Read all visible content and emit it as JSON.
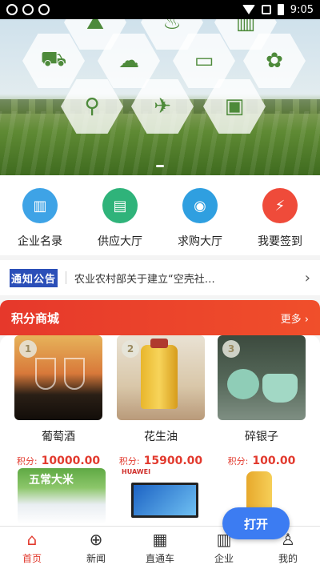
{
  "status_bar": {
    "time": "9:05"
  },
  "banner": {
    "hexagon_icons": [
      "mountain-icon",
      "pot-icon",
      "tractor-icon",
      "cloud-icon",
      "monitor-icon",
      "plant-icon",
      "search-plant-icon",
      "drone-icon",
      "wheat-icon",
      "bag-icon"
    ]
  },
  "quick_menu": [
    {
      "label": "企业名录",
      "icon": "building-icon",
      "color": "#3ea3e6",
      "glyph": "▥"
    },
    {
      "label": "供应大厅",
      "icon": "folder-icon",
      "color": "#2fb37a",
      "glyph": "▤"
    },
    {
      "label": "求购大厅",
      "icon": "basket-icon",
      "color": "#2f9fe0",
      "glyph": "◉"
    },
    {
      "label": "我要签到",
      "icon": "lightning-icon",
      "color": "#ef4b3a",
      "glyph": "⚡"
    }
  ],
  "notice": {
    "badge": "通知公告",
    "text": "农业农村部关于建立“空壳社…"
  },
  "mall": {
    "title": "积分商城",
    "more": "更多",
    "products": [
      {
        "rank": "1",
        "name": "葡萄酒",
        "price_label": "积分:",
        "price": "10000.00"
      },
      {
        "rank": "2",
        "name": "花生油",
        "price_label": "积分:",
        "price": "15900.00"
      },
      {
        "rank": "3",
        "name": "碎银子",
        "price_label": "积分:",
        "price": "100.00"
      }
    ],
    "second_row": [
      {
        "text": "五常大米"
      },
      {
        "brand": "HUAWEI"
      },
      {
        "text": ""
      }
    ]
  },
  "open_button": "打开",
  "tabs": [
    {
      "label": "首页",
      "icon": "home-icon",
      "glyph": "⌂",
      "active": true
    },
    {
      "label": "新闻",
      "icon": "globe-icon",
      "glyph": "⊕",
      "active": false
    },
    {
      "label": "直通车",
      "icon": "grid-icon",
      "glyph": "▦",
      "active": false
    },
    {
      "label": "企业",
      "icon": "bar-chart-icon",
      "glyph": "▥",
      "active": false
    },
    {
      "label": "我的",
      "icon": "user-icon",
      "glyph": "♙",
      "active": false
    }
  ]
}
